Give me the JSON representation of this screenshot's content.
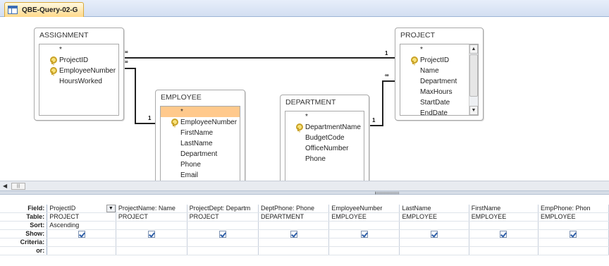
{
  "tab": {
    "title": "QBE-Query-02-G",
    "icon": "query-table-icon"
  },
  "tables": {
    "assignment": {
      "title": "ASSIGNMENT",
      "fields": [
        "*",
        "ProjectID",
        "EmployeeNumber",
        "HoursWorked"
      ],
      "key_fields": [
        1,
        2
      ]
    },
    "employee": {
      "title": "EMPLOYEE",
      "fields": [
        "*",
        "EmployeeNumber",
        "FirstName",
        "LastName",
        "Department",
        "Phone",
        "Email"
      ],
      "key_fields": [
        1
      ],
      "selected_field": 0
    },
    "department": {
      "title": "DEPARTMENT",
      "fields": [
        "*",
        "DepartmentName",
        "BudgetCode",
        "OfficeNumber",
        "Phone"
      ],
      "key_fields": [
        1
      ]
    },
    "project": {
      "title": "PROJECT",
      "fields": [
        "*",
        "ProjectID",
        "Name",
        "Department",
        "MaxHours",
        "StartDate",
        "EndDate"
      ],
      "key_fields": [
        1
      ]
    }
  },
  "relationships": {
    "assign_project": {
      "many": "∞",
      "one": "1"
    },
    "assign_employee": {
      "many": "∞",
      "one": "1"
    },
    "dept_project": {
      "many": "∞",
      "one": "1"
    }
  },
  "grid": {
    "row_headers": [
      "Field:",
      "Table:",
      "Sort:",
      "Show:",
      "Criteria:",
      "or:"
    ],
    "columns": [
      {
        "field": "ProjectID",
        "table": "PROJECT",
        "sort": "Ascending",
        "show": true
      },
      {
        "field": "ProjectName: Name",
        "table": "PROJECT",
        "sort": "",
        "show": true
      },
      {
        "field": "ProjectDept: Departm",
        "table": "PROJECT",
        "sort": "",
        "show": true
      },
      {
        "field": "DeptPhone: Phone",
        "table": "DEPARTMENT",
        "sort": "",
        "show": true
      },
      {
        "field": "EmployeeNumber",
        "table": "EMPLOYEE",
        "sort": "",
        "show": true
      },
      {
        "field": "LastName",
        "table": "EMPLOYEE",
        "sort": "",
        "show": true
      },
      {
        "field": "FirstName",
        "table": "EMPLOYEE",
        "sort": "",
        "show": true
      },
      {
        "field": "EmpPhone: Phon",
        "table": "EMPLOYEE",
        "sort": "",
        "show": true
      }
    ]
  },
  "colors": {
    "tab_bg": "#ffd98b",
    "selected_field": "#ffc98c",
    "grid_border": "#c8d0dc"
  }
}
